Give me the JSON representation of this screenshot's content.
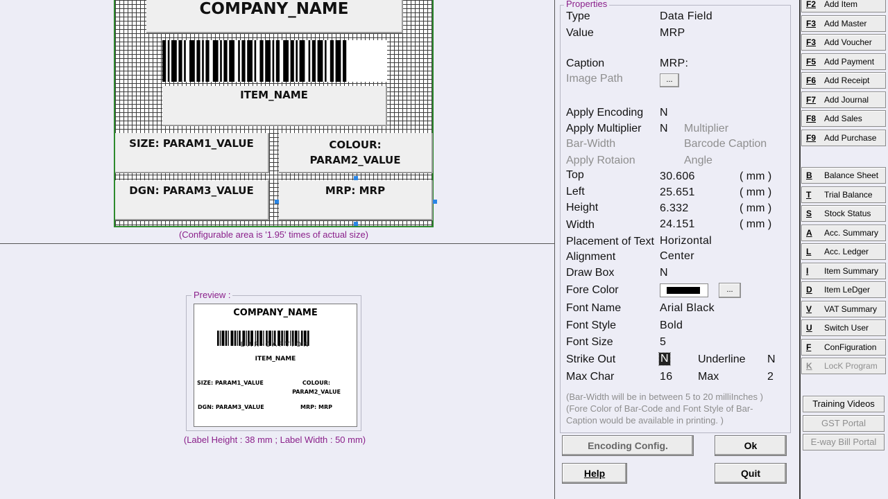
{
  "designer": {
    "fields": {
      "company": "COMPANY_NAME",
      "item": "ITEM_NAME",
      "size": "SIZE: PARAM1_VALUE",
      "colour_line1": "COLOUR:",
      "colour_line2": "PARAM2_VALUE",
      "dgn": "DGN: PARAM3_VALUE",
      "mrp": "MRP: MRP"
    },
    "note": "(Configurable area is '1.95' times of actual size)"
  },
  "preview": {
    "legend": "Preview :",
    "company": "COMPANY_NAME",
    "barcode_caption": "BAR-CAPTION",
    "item": "ITEM_NAME",
    "size": "SIZE: PARAM1_VALUE",
    "colour_line1": "COLOUR:",
    "colour_line2": "PARAM2_VALUE",
    "dgn": "DGN: PARAM3_VALUE",
    "mrp": "MRP: MRP",
    "label_note": "(Label Height : 38 mm ; Label Width : 50 mm)"
  },
  "properties": {
    "legend": "Properties",
    "type_label": "Type",
    "type_value": "Data Field",
    "value_label": "Value",
    "value_value": "MRP",
    "caption_label": "Caption",
    "caption_value": "MRP:",
    "image_path_label": "Image Path",
    "browse_label": "...",
    "apply_encoding_label": "Apply Encoding",
    "apply_encoding_value": "N",
    "apply_multiplier_label": "Apply Multiplier",
    "apply_multiplier_value": "N",
    "multiplier_label": "Multiplier",
    "bar_width_label": "Bar-Width",
    "barcode_caption_label": "Barcode Caption",
    "apply_rotation_label": "Apply Rotaion",
    "angle_label": "Angle",
    "top_label": "Top",
    "top_value": "30.606",
    "left_label": "Left",
    "left_value": "25.651",
    "height_label": "Height",
    "height_value": "6.332",
    "width_label": "Width",
    "width_value": "24.151",
    "unit": "( mm )",
    "placement_label": "Placement of Text",
    "placement_value": "Horizontal",
    "alignment_label": "Alignment",
    "alignment_value": "Center",
    "draw_box_label": "Draw Box",
    "draw_box_value": "N",
    "fore_color_label": "Fore Color",
    "fore_color_swatch": "#000000",
    "fore_color_browse": "...",
    "font_name_label": "Font Name",
    "font_name_value": "Arial Black",
    "font_style_label": "Font Style",
    "font_style_value": "Bold",
    "font_size_label": "Font Size",
    "font_size_value": "5",
    "strike_out_label": "Strike Out",
    "strike_out_value": "N",
    "underline_label": "Underline",
    "underline_value": "N",
    "max_char_label": "Max Char",
    "max_char_value": "16",
    "max_label": "Max",
    "max_value": "2",
    "note_line1": "(Bar-Width will be in between 5 to 20 milliInches )",
    "note_line2": "(Fore Color of Bar-Code and Font Style of Bar-",
    "note_line3": "Caption would be available in printing. )"
  },
  "buttons": {
    "encoding_config": "Encoding Config.",
    "ok": "Ok",
    "help": "Help",
    "quit": "Quit"
  },
  "menu": {
    "function_keys": [
      {
        "key": "F2",
        "label": "Add Item"
      },
      {
        "key": "F3",
        "label": "Add Master"
      },
      {
        "key": "F3",
        "label": "Add Voucher"
      },
      {
        "key": "F5",
        "label": "Add Payment"
      },
      {
        "key": "F6",
        "label": "Add Receipt"
      },
      {
        "key": "F7",
        "label": "Add Journal"
      },
      {
        "key": "F8",
        "label": "Add Sales"
      },
      {
        "key": "F9",
        "label": "Add Purchase"
      }
    ],
    "reports": [
      {
        "key": "B",
        "label": "Balance Sheet"
      },
      {
        "key": "T",
        "label": "Trial Balance"
      },
      {
        "key": "S",
        "label": "Stock Status"
      },
      {
        "key": "A",
        "label": "Acc. Summary"
      },
      {
        "key": "L",
        "label": "Acc. Ledger"
      },
      {
        "key": "I",
        "label": "Item Summary"
      },
      {
        "key": "D",
        "label": "Item LeDger"
      },
      {
        "key": "V",
        "label": "VAT Summary"
      },
      {
        "key": "U",
        "label": "Switch User"
      },
      {
        "key": "F",
        "label": "ConFiguration"
      },
      {
        "key": "K",
        "label": "LocK Program"
      }
    ],
    "training_videos": "Training Videos",
    "gst_portal": "GST Portal",
    "eway_portal": "E-way Bill Portal"
  }
}
